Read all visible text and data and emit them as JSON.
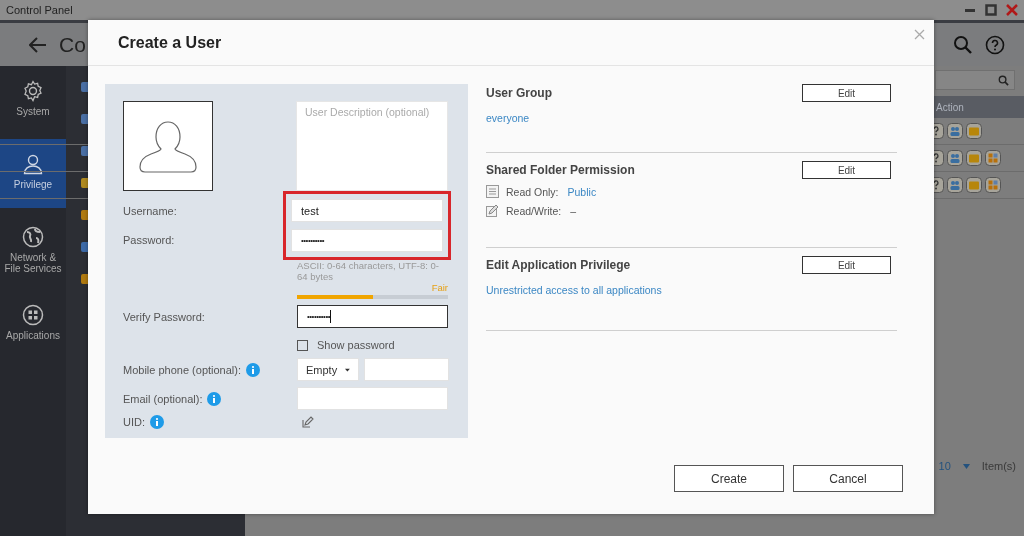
{
  "window": {
    "title": "Control Panel"
  },
  "header": {
    "title": "Co"
  },
  "sidebar": {
    "items": [
      {
        "label": "System",
        "kind": "gear",
        "selected": false
      },
      {
        "label": "Privilege",
        "kind": "user",
        "selected": true
      },
      {
        "label": "Network & File Services",
        "kind": "globe",
        "selected": false
      },
      {
        "label": "Applications",
        "kind": "apps",
        "selected": false
      }
    ]
  },
  "table": {
    "columns": [
      "Action"
    ],
    "rows": [
      {
        "app_access": false
      },
      {
        "app_access": true
      },
      {
        "app_access": true
      }
    ]
  },
  "pagination": {
    "page_size": "10",
    "unit": "Item(s)"
  },
  "dialog": {
    "title": "Create a User",
    "description": {
      "placeholder": "User Description (optional)"
    },
    "highlight_credentials": true,
    "username": {
      "label": "Username:",
      "value": "test"
    },
    "password": {
      "label": "Password:",
      "value": "••••••••••",
      "hint": "ASCII: 0-64 characters, UTF-8: 0-64 bytes",
      "strength": {
        "label": "Fair",
        "level": 0.5
      }
    },
    "verify_password": {
      "label": "Verify Password:",
      "value": "••••••••••",
      "focused": true
    },
    "show_password": {
      "label": "Show password",
      "checked": false
    },
    "mobile_phone": {
      "label": "Mobile phone (optional):",
      "country": "Empty"
    },
    "email": {
      "label": "Email (optional):"
    },
    "uid": {
      "label": "UID:"
    },
    "sections": [
      {
        "kind": "link",
        "title": "User Group",
        "button": "Edit",
        "text": "everyone"
      },
      {
        "kind": "permissions",
        "title": "Shared Folder Permission",
        "button": "Edit",
        "permissions": [
          {
            "kind": "read",
            "label": "Read Only:",
            "value": "Public"
          },
          {
            "kind": "write",
            "label": "Read/Write:",
            "value": "–"
          }
        ]
      },
      {
        "kind": "link",
        "title": "Edit Application Privilege",
        "button": "Edit",
        "text": "Unrestricted access to all applications"
      }
    ],
    "buttons": [
      "Create",
      "Cancel"
    ]
  }
}
